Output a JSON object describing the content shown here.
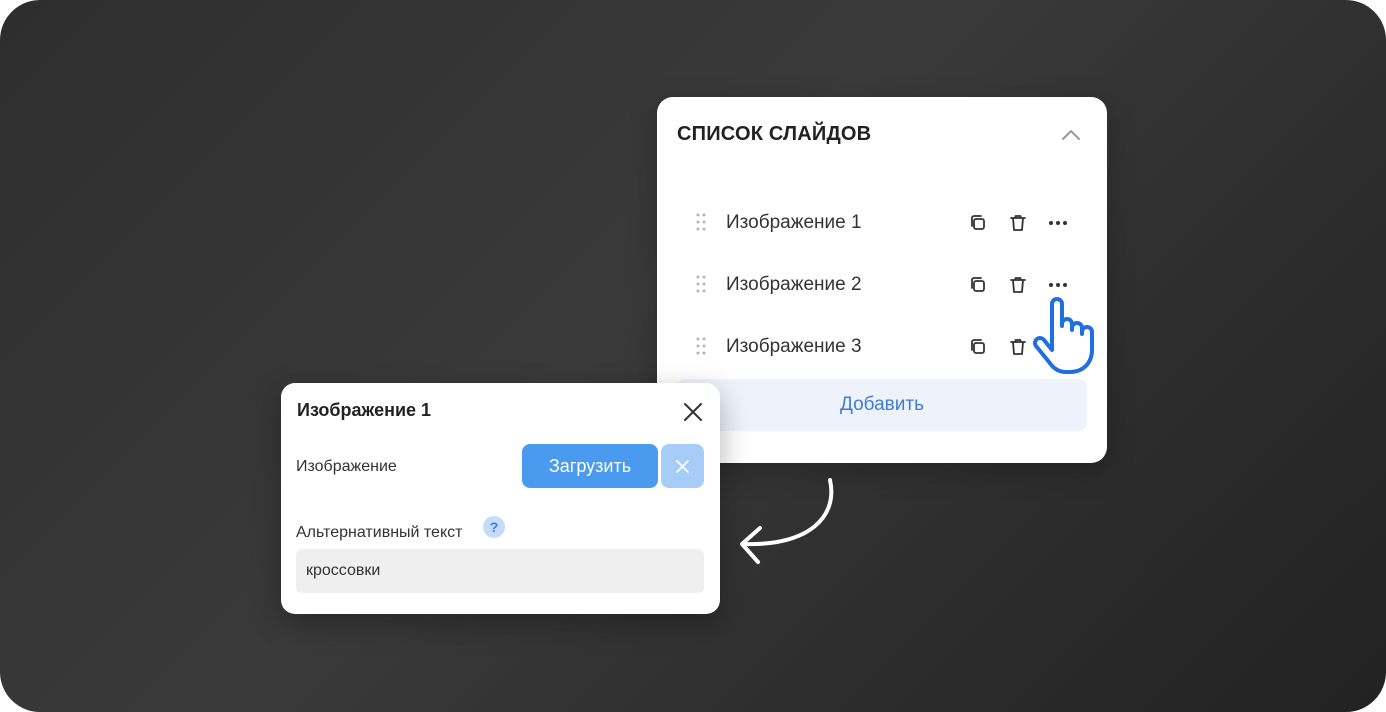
{
  "slides_panel": {
    "title": "СПИСОК СЛАЙДОВ",
    "items": [
      {
        "label": "Изображение 1"
      },
      {
        "label": "Изображение 2"
      },
      {
        "label": "Изображение 3"
      }
    ],
    "add_label": "Добавить",
    "icons": {
      "collapse": "chevron-up-icon",
      "drag": "drag-handle-icon",
      "duplicate": "copy-icon",
      "delete": "trash-icon",
      "more": "more-horizontal-icon"
    }
  },
  "edit_popup": {
    "title": "Изображение 1",
    "image_label": "Изображение",
    "upload_label": "Загрузить",
    "alt_text_label": "Альтернативный текст",
    "help_symbol": "?",
    "alt_text_value": "кроссовки"
  },
  "colors": {
    "accent_blue": "#4a9af0",
    "accent_blue_light": "#a6cdf7",
    "add_button_bg": "#eef3fb",
    "add_button_text": "#3f7cd4",
    "pointer_blue": "#1f6fe0"
  }
}
